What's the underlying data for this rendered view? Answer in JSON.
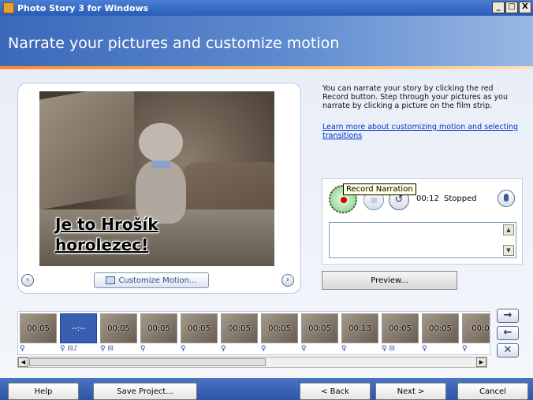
{
  "window": {
    "title": "Photo Story 3 for Windows",
    "minimize": "_",
    "maximize": "□",
    "close": "X"
  },
  "header": {
    "title": "Narrate your pictures and customize motion"
  },
  "preview": {
    "caption_line1": "Je to Hrošík",
    "caption_line2": "horolezec!",
    "customize_label": "Customize Motion...",
    "prev_glyph": "‹",
    "next_glyph": "›"
  },
  "instructions": {
    "text": "You can narrate your story by clicking the red Record button. Step through your pictures as you narrate by clicking a picture on the film strip.",
    "link": "Learn more about customizing motion and selecting transitions"
  },
  "recorder": {
    "time": "00:12",
    "status": "Stopped",
    "undo_glyph": "↺",
    "tooltip": "Record Narration",
    "notes_value": ""
  },
  "preview_button": "Preview...",
  "filmstrip": {
    "thumbnails": [
      {
        "duration": "00:05"
      },
      {
        "duration": "--:--"
      },
      {
        "duration": "00:05"
      },
      {
        "duration": "00:05"
      },
      {
        "duration": "00:05"
      },
      {
        "duration": "00:05"
      },
      {
        "duration": "00:05"
      },
      {
        "duration": "00:05"
      },
      {
        "duration": "00:13"
      },
      {
        "duration": "00:05"
      },
      {
        "duration": "00:05"
      },
      {
        "duration": "00:0"
      }
    ],
    "icons": [
      "♀",
      "♀ ⊟♪",
      "♀ ⊟",
      "♀",
      "♀",
      "♀",
      "♀",
      "♀",
      "♀",
      "♀ ⊟",
      "♀",
      "♀"
    ]
  },
  "side_buttons": {
    "right": "→",
    "left": "←",
    "remove": "✕"
  },
  "footer": {
    "help": "Help",
    "save": "Save Project...",
    "back": "< Back",
    "next": "Next >",
    "cancel": "Cancel"
  }
}
